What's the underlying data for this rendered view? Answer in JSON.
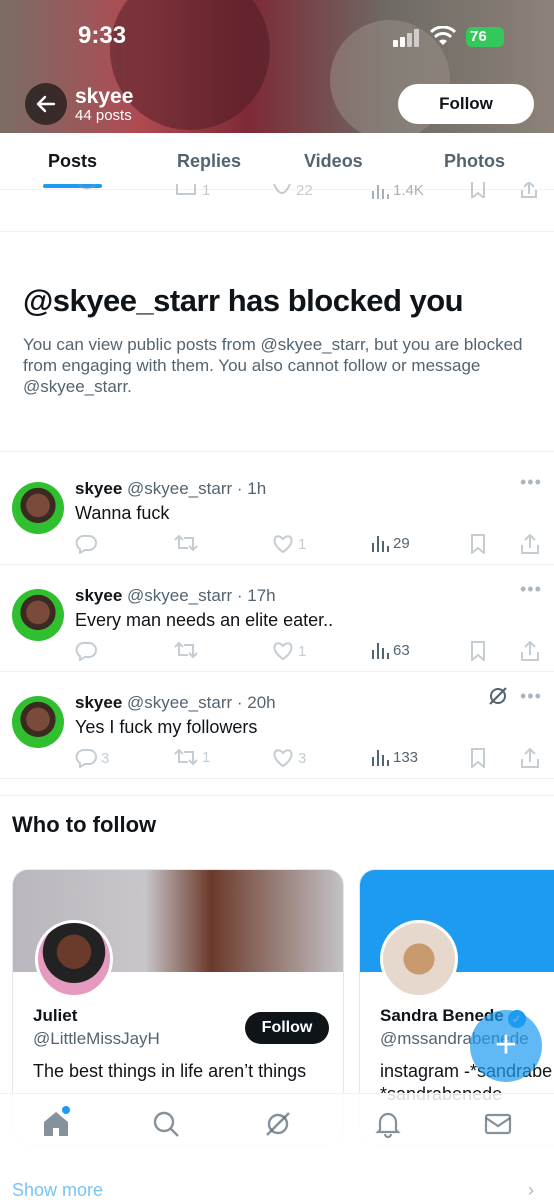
{
  "status_bar": {
    "time": "9:33",
    "battery": "76"
  },
  "header": {
    "name": "skyee",
    "post_count": "44 posts",
    "follow_label": "Follow"
  },
  "tabs": [
    {
      "label": "Posts",
      "active": true
    },
    {
      "label": "Replies",
      "active": false
    },
    {
      "label": "Videos",
      "active": false
    },
    {
      "label": "Photos",
      "active": false
    }
  ],
  "faded_post": {
    "retweets": "1",
    "likes": "22",
    "views": "1.4K"
  },
  "blocked": {
    "title": "@skyee_starr has blocked you",
    "text": "You can view public posts from @skyee_starr, but you are blocked from engaging with them. You also cannot follow or message @skyee_starr."
  },
  "posts": [
    {
      "name": "skyee",
      "handle": "@skyee_starr",
      "time": "1h",
      "text": "Wanna fuck",
      "replies": "",
      "retweets": "",
      "likes": "1",
      "views": "29"
    },
    {
      "name": "skyee",
      "handle": "@skyee_starr",
      "time": "17h",
      "text": "Every man needs an elite eater..",
      "replies": "",
      "retweets": "",
      "likes": "1",
      "views": "63"
    },
    {
      "name": "skyee",
      "handle": "@skyee_starr",
      "time": "20h",
      "text": "Yes I fuck my followers",
      "replies": "3",
      "retweets": "1",
      "likes": "3",
      "views": "133"
    }
  ],
  "who_to_follow": {
    "title": "Who to follow",
    "cards": [
      {
        "name": "Juliet",
        "handle": "@LittleMissJayH",
        "bio": "The best things in life aren’t things",
        "follow_label": "Follow"
      },
      {
        "name": "Sandra Benede",
        "handle": "@mssandrabenede",
        "bio_line1": "instagram -*sandrabe",
        "bio_line2": "*sandrabenede",
        "verified": true
      }
    ]
  },
  "fab_label": "+",
  "show_more": "Show more",
  "colors": {
    "accent": "#1d9bf0",
    "text": "#0f1419",
    "secondary": "#536471"
  }
}
